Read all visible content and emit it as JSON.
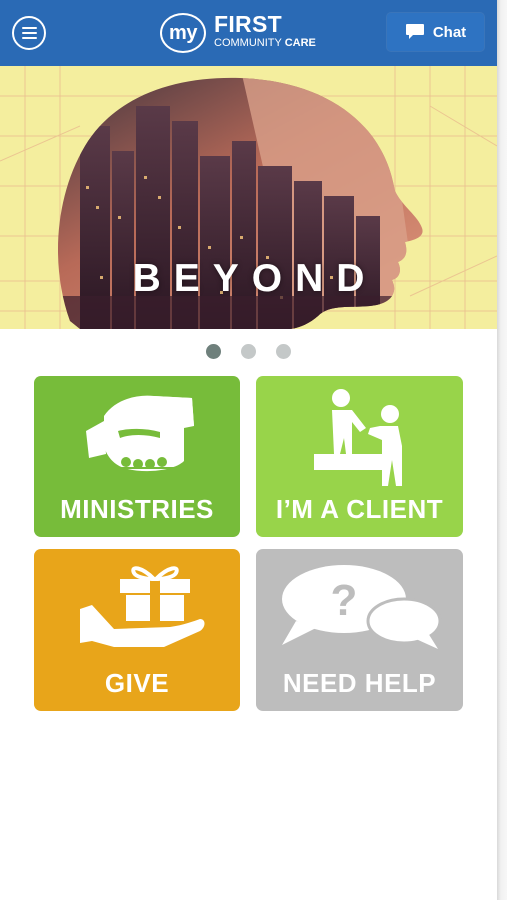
{
  "header": {
    "menu_icon": "hamburger-menu-icon",
    "logo": {
      "my": "my",
      "first": "FIRST",
      "community": "COMMUNITY",
      "care": "CARE"
    },
    "chat_icon": "chat-bubble-icon",
    "chat_label": "Chat"
  },
  "hero": {
    "title": "BEYOND",
    "slides": 3,
    "active_slide": 1
  },
  "tiles": [
    {
      "label": "MINISTRIES",
      "icon": "handshake-fist-icon",
      "color": "#77bc3a"
    },
    {
      "label": "I’M A CLIENT",
      "icon": "helping-hand-people-icon",
      "color": "#98d44a"
    },
    {
      "label": "GIVE",
      "icon": "gift-in-hand-icon",
      "color": "#e8a51a"
    },
    {
      "label": "NEED HELP",
      "icon": "question-speech-bubbles-icon",
      "color": "#bdbdbd"
    }
  ],
  "colors": {
    "header": "#2a6ab5",
    "hero_background": "#f4ee9e"
  }
}
